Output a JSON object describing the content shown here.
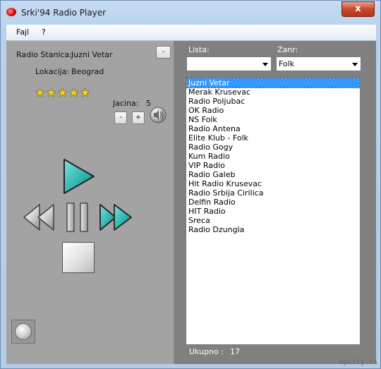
{
  "window": {
    "title": "Srki'94 Radio Player",
    "close_glyph": "x"
  },
  "menu": {
    "items": [
      "Fajl",
      "?"
    ]
  },
  "info": {
    "station_label": "Radio Stanica:",
    "station_value": "Juzni Vetar",
    "location_label": "Lokacija:",
    "location_value": "Beograd",
    "collapse_button": "-",
    "rating": 5
  },
  "volume": {
    "label": "Jacina:",
    "value": "5",
    "minus": "-",
    "plus": "+"
  },
  "filters": {
    "list_label": "Lista:",
    "list_value": "",
    "genre_label": "Zanr:",
    "genre_value": "Folk"
  },
  "stations": {
    "selected": "Juzni Vetar",
    "items": [
      "Juzni Vetar",
      "Merak Krusevac",
      "Radio Poljubac",
      "OK Radio",
      "NS Folk",
      "Radio Antena",
      "Elite Klub - Folk",
      "Radio Gogy",
      "Kum Radio",
      "VIP Radio",
      "Radio Galeb",
      "Hit Radio Krusevac",
      "Radio Srbija Cirilica",
      "Delfin Radio",
      "HIT Radio",
      "Sreca",
      "Radio Dzungla"
    ]
  },
  "footer": {
    "total_label": "Ukupno :",
    "total_value": "17"
  },
  "watermark": "mycity.rs",
  "colors": {
    "accent_teal": "#2fb5b0",
    "selection": "#3399ff",
    "left_panel": "#a3a3a3",
    "right_panel": "#808080"
  }
}
